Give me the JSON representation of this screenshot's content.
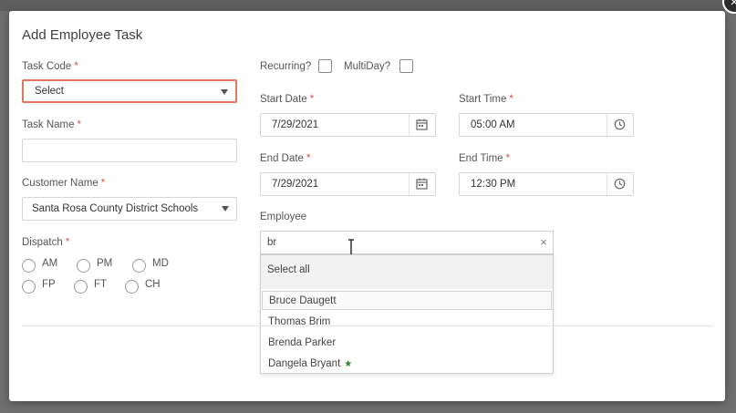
{
  "modal": {
    "title": "Add Employee Task",
    "close_symbol": "×"
  },
  "form": {
    "task_code": {
      "label": "Task Code",
      "required": "*",
      "value": "Select"
    },
    "task_name": {
      "label": "Task Name",
      "required": "*",
      "value": ""
    },
    "customer_name": {
      "label": "Customer Name",
      "required": "*",
      "value": "Santa Rosa County District Schools"
    },
    "dispatch": {
      "label": "Dispatch",
      "required": "*",
      "options": [
        "AM",
        "PM",
        "MD",
        "FP",
        "FT",
        "CH"
      ]
    },
    "recurring": {
      "label": "Recurring?"
    },
    "multiday": {
      "label": "MultiDay?"
    },
    "start_date": {
      "label": "Start Date",
      "required": "*",
      "value": "7/29/2021"
    },
    "start_time": {
      "label": "Start Time",
      "required": "*",
      "value": "05:00 AM"
    },
    "end_date": {
      "label": "End Date",
      "required": "*",
      "value": "7/29/2021"
    },
    "end_time": {
      "label": "End Time",
      "required": "*",
      "value": "12:30 PM"
    },
    "employee": {
      "label": "Employee",
      "query": "br",
      "clear_symbol": "×",
      "select_all": "Select all",
      "options": [
        "Bruce Daugett",
        "Thomas Brim",
        "Brenda Parker",
        "Dangela Bryant"
      ],
      "star_symbol": "★"
    }
  },
  "colors": {
    "required": "#d9534f",
    "focus_border": "#e07a5f",
    "star": "#2e7d32"
  },
  "icons": [
    "close-icon",
    "chevron-down-icon",
    "calendar-icon",
    "clock-icon",
    "star-icon",
    "text-cursor-icon"
  ]
}
